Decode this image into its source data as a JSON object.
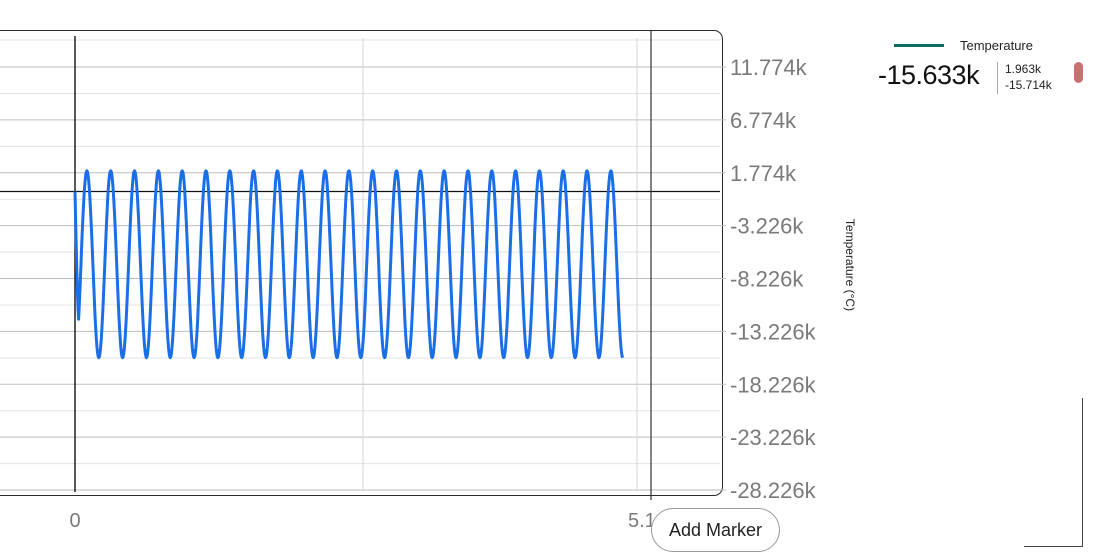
{
  "chart_data": {
    "type": "line",
    "title": "",
    "ylabel": "Temperature (°C)",
    "xlabel": "",
    "y_ticks": [
      "11.774k",
      "6.774k",
      "1.774k",
      "-3.226k",
      "-8.226k",
      "-13.226k",
      "-18.226k",
      "-23.226k",
      "-28.226k"
    ],
    "x_ticks": [
      "0",
      "5.1"
    ],
    "ylim": [
      -28226,
      11774
    ],
    "xlim": [
      0,
      5.1
    ],
    "grid": true,
    "legend_position": "top-right",
    "series": [
      {
        "name": "Temperature",
        "color": "#1a6fe8",
        "x_start": 0,
        "x_end": 4.85,
        "cycles": 23,
        "max": 1963,
        "min": -15714,
        "start_value": 0
      }
    ]
  },
  "legend": {
    "name": "Temperature",
    "current_value": "-15.633k",
    "max_value": "1.963k",
    "min_value": "-15.714k",
    "swatch_color": "#0e6b6b",
    "handle_color": "#c97070"
  },
  "buttons": {
    "add_marker": "Add Marker"
  }
}
